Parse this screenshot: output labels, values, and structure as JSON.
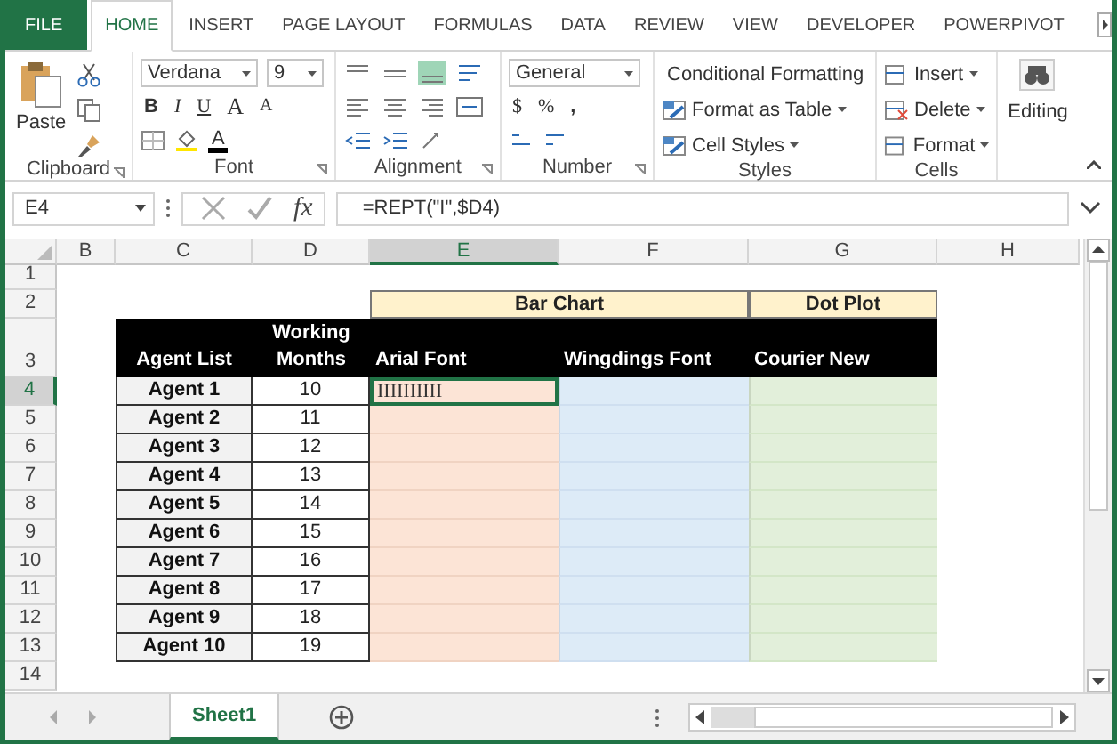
{
  "ribbon_tabs": [
    {
      "label": "FILE",
      "kind": "file",
      "selected": false
    },
    {
      "label": "HOME",
      "kind": "tab",
      "selected": true
    },
    {
      "label": "INSERT",
      "kind": "tab",
      "selected": false
    },
    {
      "label": "PAGE LAYOUT",
      "kind": "tab",
      "selected": false
    },
    {
      "label": "FORMULAS",
      "kind": "tab",
      "selected": false
    },
    {
      "label": "DATA",
      "kind": "tab",
      "selected": false
    },
    {
      "label": "REVIEW",
      "kind": "tab",
      "selected": false
    },
    {
      "label": "VIEW",
      "kind": "tab",
      "selected": false
    },
    {
      "label": "DEVELOPER",
      "kind": "tab",
      "selected": false
    },
    {
      "label": "POWERPIVOT",
      "kind": "tab",
      "selected": false
    }
  ],
  "clipboard": {
    "paste": "Paste",
    "label": "Clipboard"
  },
  "font": {
    "family": "Verdana",
    "size": "9",
    "bold": "B",
    "italic": "I",
    "underline": "U",
    "grow": "A",
    "shrink": "A",
    "color_letter": "A",
    "label": "Font"
  },
  "alignment": {
    "bottom_aligned": true,
    "label": "Alignment"
  },
  "number": {
    "format": "General",
    "currency": "$",
    "percent": "%",
    "comma": ",",
    "label": "Number"
  },
  "styles": {
    "items": [
      "Conditional Formatting",
      "Format as Table",
      "Cell Styles"
    ],
    "label": "Styles"
  },
  "cells": {
    "items": [
      "Insert",
      "Delete",
      "Format"
    ],
    "label": "Cells"
  },
  "editing": {
    "label": "Editing"
  },
  "formula_bar": {
    "name_box": "E4",
    "fx": "fx",
    "formula": "=REPT(\"I\",$D4)"
  },
  "columns": [
    {
      "label": "B",
      "selected": false
    },
    {
      "label": "C",
      "selected": false
    },
    {
      "label": "D",
      "selected": false
    },
    {
      "label": "E",
      "selected": true
    },
    {
      "label": "F",
      "selected": false
    },
    {
      "label": "G",
      "selected": false
    },
    {
      "label": "H",
      "selected": false
    }
  ],
  "row_numbers": [
    {
      "label": "1",
      "selected": false
    },
    {
      "label": "2",
      "selected": false
    },
    {
      "label": "3",
      "selected": false
    },
    {
      "label": "4",
      "selected": true
    },
    {
      "label": "5",
      "selected": false
    },
    {
      "label": "6",
      "selected": false
    },
    {
      "label": "7",
      "selected": false
    },
    {
      "label": "8",
      "selected": false
    },
    {
      "label": "9",
      "selected": false
    },
    {
      "label": "10",
      "selected": false
    },
    {
      "label": "11",
      "selected": false
    },
    {
      "label": "12",
      "selected": false
    },
    {
      "label": "13",
      "selected": false
    },
    {
      "label": "14",
      "selected": false
    }
  ],
  "table": {
    "group_headers": [
      "Bar Chart",
      "Dot Plot"
    ],
    "headers": [
      "Agent List",
      "Working Months",
      "Arial Font",
      "Wingdings Font",
      "Courier New"
    ],
    "rows": [
      {
        "agent": "Agent 1",
        "months": "10",
        "bar": "IIIIIIIIII",
        "selected": true
      },
      {
        "agent": "Agent 2",
        "months": "11",
        "selected": false
      },
      {
        "agent": "Agent 3",
        "months": "12",
        "selected": false
      },
      {
        "agent": "Agent 4",
        "months": "13",
        "selected": false
      },
      {
        "agent": "Agent 5",
        "months": "14",
        "selected": false
      },
      {
        "agent": "Agent 6",
        "months": "15",
        "selected": false
      },
      {
        "agent": "Agent 7",
        "months": "16",
        "selected": false
      },
      {
        "agent": "Agent 8",
        "months": "17",
        "selected": false
      },
      {
        "agent": "Agent 9",
        "months": "18",
        "selected": false
      },
      {
        "agent": "Agent 10",
        "months": "19",
        "selected": false
      }
    ]
  },
  "sheet_tabs": [
    {
      "label": "Sheet1",
      "selected": true
    }
  ]
}
